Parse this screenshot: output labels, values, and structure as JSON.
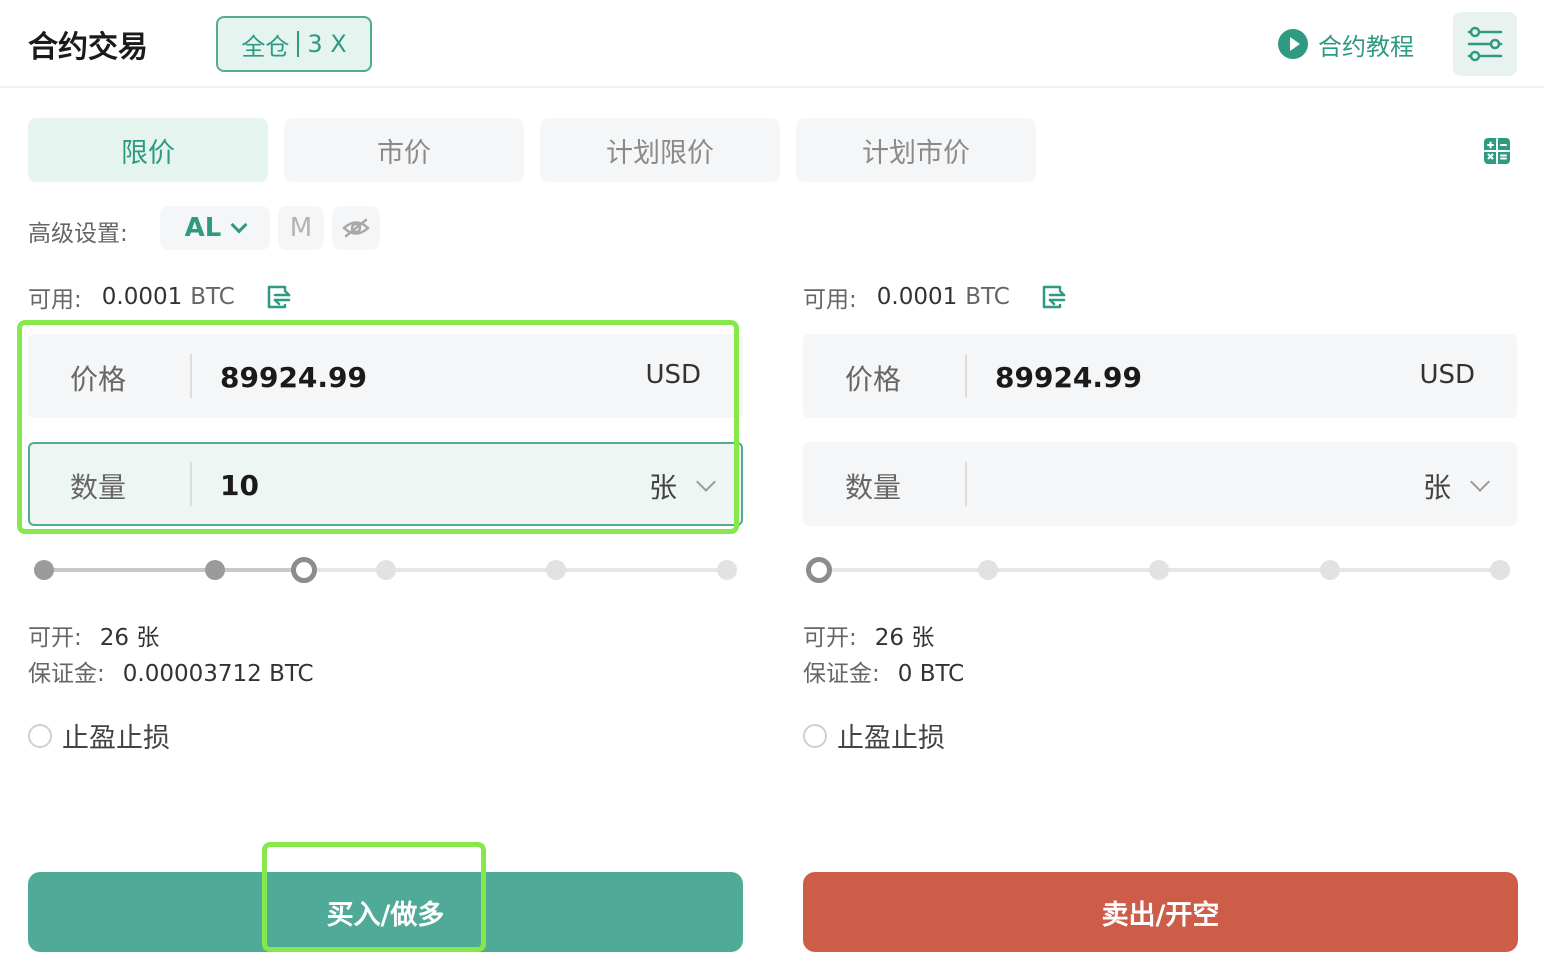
{
  "header": {
    "title": "合约交易",
    "mode_left": "全仓",
    "mode_right": "3 X",
    "tutorial_label": "合约教程"
  },
  "tabs": [
    {
      "label": "限价",
      "active": true
    },
    {
      "label": "市价",
      "active": false
    },
    {
      "label": "计划限价",
      "active": false
    },
    {
      "label": "计划市价",
      "active": false
    }
  ],
  "advanced": {
    "label": "高级设置:",
    "al": "AL",
    "m": "M"
  },
  "buy_panel": {
    "avail_label": "可用:",
    "avail_value": "0.0001",
    "avail_unit": "BTC",
    "price_label": "价格",
    "price_value": "89924.99",
    "price_unit": "USD",
    "qty_label": "数量",
    "qty_value": "10",
    "qty_unit": "张",
    "slider_level_percent": 40,
    "open_label": "可开:",
    "open_value": "26 张",
    "margin_label": "保证金:",
    "margin_value": "0.00003712 BTC",
    "tpsl_label": "止盈止损",
    "action_label": "买入/做多"
  },
  "sell_panel": {
    "avail_label": "可用:",
    "avail_value": "0.0001",
    "avail_unit": "BTC",
    "price_label": "价格",
    "price_value": "89924.99",
    "price_unit": "USD",
    "qty_label": "数量",
    "qty_value": "",
    "qty_unit": "张",
    "slider_level_percent": 0,
    "open_label": "可开:",
    "open_value": "26 张",
    "margin_label": "保证金:",
    "margin_value": "0 BTC",
    "tpsl_label": "止盈止损",
    "action_label": "卖出/开空"
  },
  "colors": {
    "accent": "#2f9a82",
    "buy": "#4fab97",
    "sell": "#cd5c48",
    "highlight": "#86e84a"
  },
  "icons": [
    "play-icon",
    "settings-sliders-icon",
    "calculator-icon",
    "chevron-down-icon",
    "eye-off-icon",
    "transfer-icon"
  ]
}
